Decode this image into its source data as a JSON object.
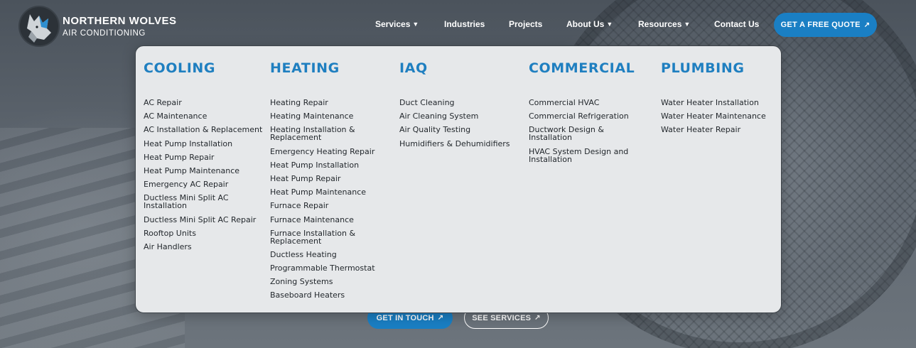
{
  "brand": {
    "title": "NORTHERN WOLVES",
    "subtitle": "AIR CONDITIONING",
    "logo_icon": "wolf-logo-icon"
  },
  "nav": {
    "items": [
      {
        "label": "Services",
        "has_dropdown": true
      },
      {
        "label": "Industries",
        "has_dropdown": false
      },
      {
        "label": "Projects",
        "has_dropdown": false
      },
      {
        "label": "About Us",
        "has_dropdown": true
      },
      {
        "label": "Resources",
        "has_dropdown": true
      },
      {
        "label": "Contact Us",
        "has_dropdown": false
      }
    ],
    "dropdown_icon": "caret-down-icon",
    "quote_label": "GET A FREE QUOTE",
    "arrow": "↗"
  },
  "mega_menu": {
    "columns": [
      {
        "title": "COOLING",
        "items": [
          "AC Repair",
          "AC Maintenance",
          "AC Installation & Replacement",
          "Heat Pump Installation",
          "Heat Pump Repair",
          "Heat Pump Maintenance",
          "Emergency AC Repair",
          "Ductless Mini Split AC Installation",
          "Ductless Mini Split AC Repair",
          "Rooftop Units",
          "Air Handlers"
        ]
      },
      {
        "title": "HEATING",
        "items": [
          "Heating Repair",
          "Heating Maintenance",
          "Heating Installation & Replacement",
          "Emergency Heating Repair",
          "Heat Pump Installation",
          "Heat Pump Repair",
          "Heat Pump Maintenance",
          "Furnace Repair",
          "Furnace Maintenance",
          "Furnace Installation & Replacement",
          "Ductless Heating",
          "Programmable Thermostat",
          "Zoning Systems",
          "Baseboard Heaters"
        ]
      },
      {
        "title": "IAQ",
        "items": [
          "Duct Cleaning",
          "Air Cleaning System",
          "Air Quality Testing",
          "Humidifiers & Dehumidifiers"
        ]
      },
      {
        "title": "COMMERCIAL",
        "items": [
          "Commercial HVAC",
          "Commercial Refrigeration",
          "Ductwork Design & Installation",
          "HVAC System Design and Installation"
        ]
      },
      {
        "title": "PLUMBING",
        "items": [
          "Water Heater Installation",
          "Water Heater Maintenance",
          "Water Heater Repair"
        ]
      }
    ]
  },
  "hero": {
    "primary_cta": "GET IN TOUCH",
    "secondary_cta": "SEE SERVICES",
    "arrow": "↗"
  },
  "colors": {
    "accent": "#1a7fc4",
    "menu_heading": "#1f7fc0",
    "menu_bg": "#e6e8ea"
  }
}
